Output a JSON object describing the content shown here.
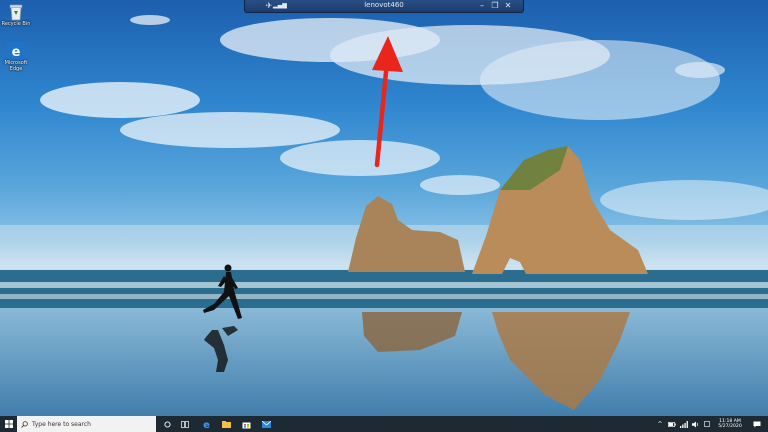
{
  "desktop": {
    "icons": [
      {
        "label": "Recycle Bin",
        "icon": "recycle-bin-icon"
      },
      {
        "label": "Microsoft Edge",
        "icon": "edge-icon"
      }
    ]
  },
  "remote_bar": {
    "title": "lenovot460",
    "pin_glyph": "✈",
    "minimize_glyph": "–",
    "restore_glyph": "❐",
    "close_glyph": "✕"
  },
  "taskbar": {
    "search_placeholder": "Type here to search",
    "pinned": [
      "cortana-icon",
      "task-view-icon",
      "edge-icon",
      "file-explorer-icon",
      "store-icon",
      "mail-icon"
    ],
    "clock_time": "11:18 AM",
    "clock_date": "5/27/2020"
  },
  "colors": {
    "annotation_arrow": "#e8261c",
    "taskbar_bg": "#1e2a33",
    "remote_bar_bg": "#1d3c6c"
  }
}
